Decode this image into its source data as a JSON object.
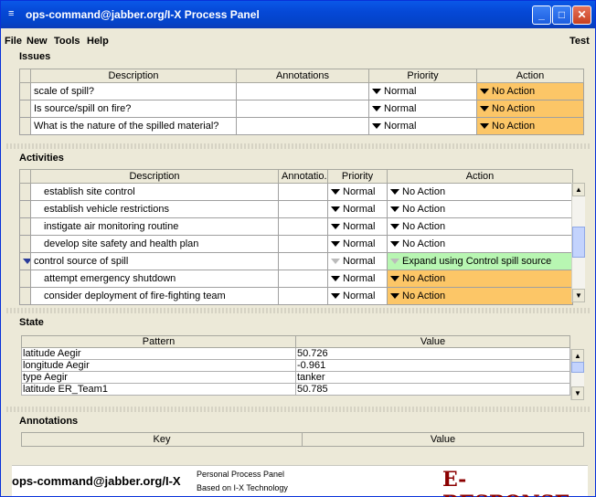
{
  "window": {
    "title": "ops-command@jabber.org/I-X Process Panel"
  },
  "menu": {
    "items": [
      "File",
      "New",
      "Tools",
      "Help"
    ],
    "right_label": "Test"
  },
  "issues": {
    "label": "Issues",
    "columns": [
      "Description",
      "Annotations",
      "Priority",
      "Action"
    ],
    "rows": [
      {
        "description": "scale of spill?",
        "annotations": "",
        "priority": "Normal",
        "action": "No Action"
      },
      {
        "description": "Is source/spill on fire?",
        "annotations": "",
        "priority": "Normal",
        "action": "No Action"
      },
      {
        "description": "What is the nature of the spilled material?",
        "annotations": "",
        "priority": "Normal",
        "action": "No Action"
      }
    ]
  },
  "activities": {
    "label": "Activities",
    "columns": [
      "Description",
      "Annotatio...",
      "Priority",
      "Action"
    ],
    "rows": [
      {
        "description": "establish site control",
        "annotations": "",
        "priority": "Normal",
        "action": "No Action"
      },
      {
        "description": "establish vehicle restrictions",
        "annotations": "",
        "priority": "Normal",
        "action": "No Action"
      },
      {
        "description": "instigate air monitoring routine",
        "annotations": "",
        "priority": "Normal",
        "action": "No Action"
      },
      {
        "description": "develop site safety and health plan",
        "annotations": "",
        "priority": "Normal",
        "action": "No Action"
      },
      {
        "description": "control source of spill",
        "annotations": "",
        "priority": "Normal",
        "action": "Expand using Control spill source"
      },
      {
        "description": "attempt emergency shutdown",
        "annotations": "",
        "priority": "Normal",
        "action": "No Action"
      },
      {
        "description": "consider deployment of fire-fighting team",
        "annotations": "",
        "priority": "Normal",
        "action": "No Action"
      }
    ]
  },
  "state": {
    "label": "State",
    "columns": [
      "Pattern",
      "Value"
    ],
    "rows": [
      {
        "pattern": "latitude Aegir",
        "value": "50.726"
      },
      {
        "pattern": "longitude Aegir",
        "value": "-0.961"
      },
      {
        "pattern": "type Aegir",
        "value": "tanker"
      },
      {
        "pattern": "latitude ER_Team1",
        "value": "50.785"
      }
    ]
  },
  "annotations": {
    "label": "Annotations",
    "columns": [
      "Key",
      "Value"
    ]
  },
  "footer": {
    "user": "ops-command@jabber.org/I-X",
    "line1": "Personal Process Panel",
    "line2": "Based on I-X Technology",
    "logo": "E-RESPONSE"
  },
  "colors": {
    "action_orange": "#fcc667",
    "action_green": "#b8f6b2",
    "titlebar": "#0548d6",
    "logo": "#8b0000"
  }
}
